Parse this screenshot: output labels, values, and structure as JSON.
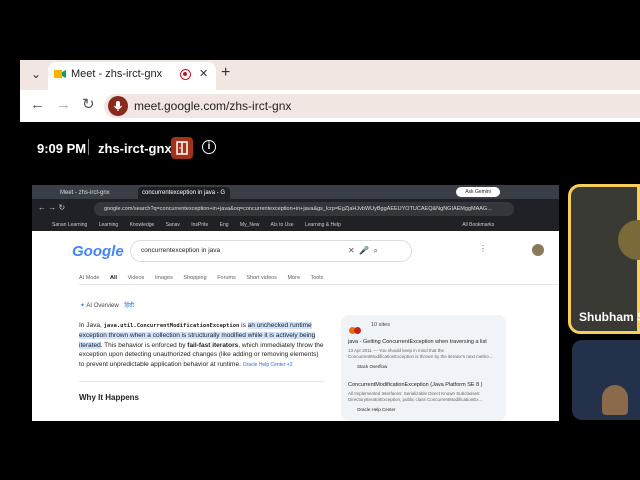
{
  "browser": {
    "tab": {
      "title": "Meet - zhs-irct-gnx"
    },
    "url": "meet.google.com/zhs-irct-gnx"
  },
  "meet": {
    "time": "9:09 PM",
    "code": "zhs-irct-gnx",
    "participant": "Shubham S"
  },
  "shared": {
    "tabs": [
      "Meet - zhs-irct-gnx",
      "concurrentexception in java - G"
    ],
    "ask_gemini": "Ask Gemini",
    "url": "google.com/search?q=concurrentexception+in+java&oq=concurrentexception+in+java&gs_lcrp=EgZjaHJvbWUyBggAEEUYOTUCAEQ&NgNGIAEMggMAAG...",
    "bookmarks": [
      "Sanan Learning",
      "Learning",
      "Knowledge",
      "Sanav",
      "InsPrite",
      "Eng",
      "My_New",
      "AIs to Use",
      "Learning & Help",
      "All Bookmarks"
    ],
    "search_query": "concurrentexception in java",
    "search_tabs": [
      "AI Mode",
      "All",
      "Videos",
      "Images",
      "Shopping",
      "Forums",
      "Short videos",
      "More",
      "Tools"
    ],
    "ai_overview_label": "AI Overview",
    "ai_lang": "हिंदी",
    "ai_p1": "In Java, ",
    "ai_code": "java.util.ConcurrentModificationException",
    "ai_p2": " is ",
    "ai_hl": "an unchecked runtime exception thrown when a collection is structurally modified while it is actively being iterated",
    "ai_p3": ". This behavior is enforced by ",
    "ai_bold": "fail-fast iterators",
    "ai_p4": ", which immediately throw the exception upon detecting unauthorized changes (like adding or removing elements) to prevent unpredictable application behavior at runtime.",
    "ai_cite": "Oracle Help Center +2",
    "section_heading": "Why It Happens",
    "sites_label": "10 sites",
    "side": {
      "r1_title": "java - Getting ConcurrentException when traversing a list",
      "r1_meta": "13 Apr 2011 — You should keep in mind that the",
      "r1_meta2": "ConcurrentModificationException is thrown by the iterator's next metho...",
      "r1_src": "Stack Overflow",
      "r2_title": "ConcurrentModificationException (Java Platform SE 8 )",
      "r2_meta": "All Implemented Interfaces: Serializable Direct Known Subclasses:",
      "r2_meta2": "DirectoryIteratorException, public class ConcurrentModificationEx...",
      "r2_src": "Oracle Help Center"
    }
  },
  "colors": {
    "accent": "#f7cf5a",
    "record": "#c4122b",
    "highlight": "#d2e3fc"
  }
}
